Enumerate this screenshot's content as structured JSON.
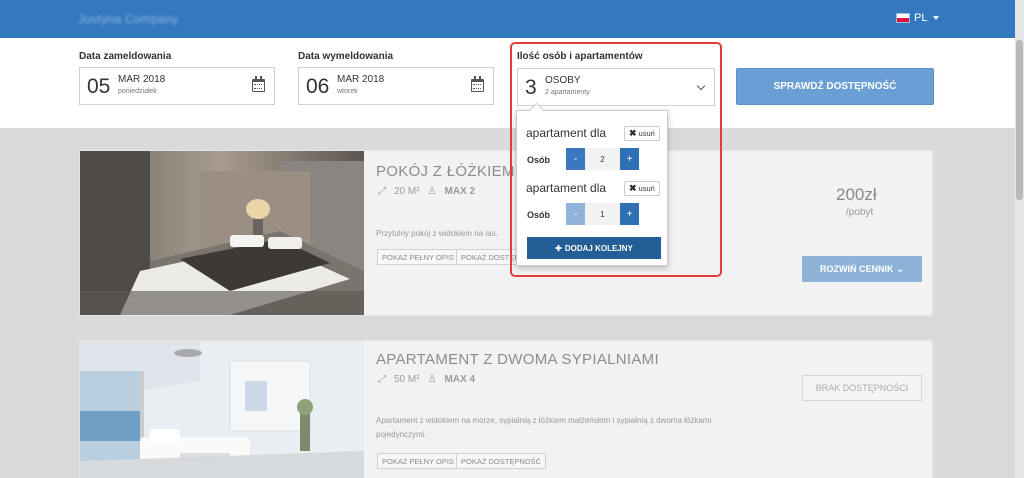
{
  "header": {
    "brand": "Justyna Company",
    "lang": "PL"
  },
  "search": {
    "checkin": {
      "label": "Data zameldowania",
      "day": "05",
      "month": "MAR 2018",
      "weekday": "poniedziałek"
    },
    "checkout": {
      "label": "Data wymeldowania",
      "day": "06",
      "month": "MAR 2018",
      "weekday": "wtorek"
    },
    "guests": {
      "label": "Ilość osób i apartamentów",
      "count": "3",
      "unit": "OSOBY",
      "sub": "2 apartamenty"
    },
    "check_button": "SPRAWDŹ DOSTĘPNOŚĆ"
  },
  "dropdown": {
    "apartments": [
      {
        "title": "apartament dla",
        "remove": "usuń",
        "persons_label": "Osób",
        "value": "2",
        "minus": "-",
        "plus": "+"
      },
      {
        "title": "apartament dla",
        "remove": "usuń",
        "persons_label": "Osób",
        "value": "1",
        "minus": "-",
        "plus": "+"
      }
    ],
    "add_button": "DODAJ KOLEJNY"
  },
  "rooms": [
    {
      "title": "POKÓJ Z ŁÓŻKIEM MA",
      "area": "20 M²",
      "max": "MAX 2",
      "description": "Przytulny pokój z widokiem na las.",
      "btn_full": "POKAŻ PEŁNY OPIS",
      "btn_avail": "POKAŻ DOSTĘPNOŚĆ",
      "price": "200zł",
      "price_unit": "/pobyt",
      "expand": "ROZWIŃ CENNIK"
    },
    {
      "title": "APARTAMENT Z DWOMA SYPIALNIAMI",
      "area": "50 M²",
      "max": "MAX 4",
      "description": "Apartament z widokiem na morze, sypialnią z łóżkiem małżeńskim i sypialnią z dwoma łóżkami pojedynczymi.",
      "btn_full": "POKAŻ PEŁNY OPIS",
      "btn_avail": "POKAŻ DOSTĘPNOŚĆ",
      "unavailable": "BRAK DOSTĘPNOŚCI"
    }
  ]
}
